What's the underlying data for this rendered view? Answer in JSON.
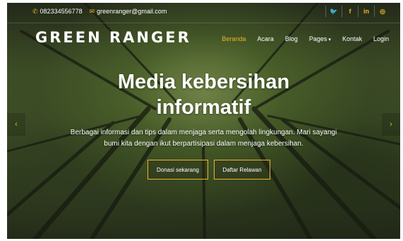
{
  "topbar": {
    "phone": "082334556778",
    "email": "greenranger@gmail.com"
  },
  "social": [
    {
      "label": "🐦",
      "icon": "twitter-icon"
    },
    {
      "label": "f",
      "icon": "facebook-icon"
    },
    {
      "label": "in",
      "icon": "linkedin-icon"
    },
    {
      "label": "◎",
      "icon": "instagram-icon"
    }
  ],
  "brand": "GREEN RANGER",
  "nav": {
    "items": [
      {
        "label": "Beranda",
        "active": true
      },
      {
        "label": "Acara"
      },
      {
        "label": "Blog"
      },
      {
        "label": "Pages"
      },
      {
        "label": "Kontak"
      },
      {
        "label": "Login"
      }
    ]
  },
  "hero": {
    "title_line1": "Media kebersihan",
    "title_line2": "informatif",
    "subtitle": "Berbagai informasi dan tips dalam menjaga serta mengolah lingkungan. Mari sayangi bumi kita dengan ikut berpartisipasi dalam menjaga kebersihan.",
    "donate_label": "Donasi sekarang",
    "volunteer_label": "Daftar Relawan"
  },
  "colors": {
    "accent": "#f0b429",
    "text": "#ffffff"
  }
}
